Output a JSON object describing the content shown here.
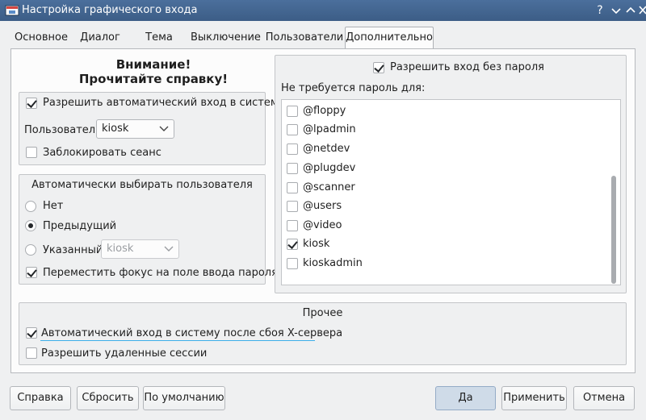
{
  "window": {
    "title": "Настройка графического входа",
    "controls": [
      "help-icon",
      "minimize-icon",
      "maximize-icon",
      "close-icon"
    ]
  },
  "tabs": [
    {
      "label": "Основное"
    },
    {
      "label": "Диалог"
    },
    {
      "label": "Тема"
    },
    {
      "label": "Выключение"
    },
    {
      "label": "Пользователи"
    },
    {
      "label": "Дополнительно",
      "active": true
    }
  ],
  "left": {
    "warning_line1": "Внимание!",
    "warning_line2": "Прочитайте справку!",
    "autologin": {
      "enable_label": "Разрешить автоматический вход в систему",
      "enable_checked": true,
      "user_label": "Пользователь:",
      "user_value": "kiosk",
      "lock_label": "Заблокировать сеанс",
      "lock_checked": false
    },
    "preselect": {
      "title": "Автоматически выбирать пользователя",
      "none_label": "Нет",
      "previous_label": "Предыдущий",
      "specified_label": "Указанный:",
      "specified_value": "kiosk",
      "selected": "previous",
      "focus_label": "Переместить фокус на поле ввода пароля",
      "focus_checked": true
    }
  },
  "right": {
    "nopass_label": "Разрешить вход без пароля",
    "nopass_checked": true,
    "list_title": "Не требуется пароль для:",
    "items": [
      {
        "label": "@floppy",
        "checked": false
      },
      {
        "label": "@lpadmin",
        "checked": false
      },
      {
        "label": "@netdev",
        "checked": false
      },
      {
        "label": "@plugdev",
        "checked": false
      },
      {
        "label": "@scanner",
        "checked": false
      },
      {
        "label": "@users",
        "checked": false
      },
      {
        "label": "@video",
        "checked": false
      },
      {
        "label": "kiosk",
        "checked": true
      },
      {
        "label": "kioskadmin",
        "checked": false
      }
    ]
  },
  "misc": {
    "title": "Прочее",
    "crash_autologin_label": "Автоматический вход в систему после сбоя X-сервера",
    "crash_autologin_checked": true,
    "remote_sessions_label": "Разрешить удаленные сессии",
    "remote_sessions_checked": false
  },
  "buttons": {
    "help": "Справка",
    "reset": "Сбросить",
    "defaults": "По умолчанию",
    "ok": "Да",
    "apply": "Применить",
    "cancel": "Отмена"
  },
  "colors": {
    "titlebar": "#4b6f9c",
    "focus_accent": "#3daee9"
  }
}
